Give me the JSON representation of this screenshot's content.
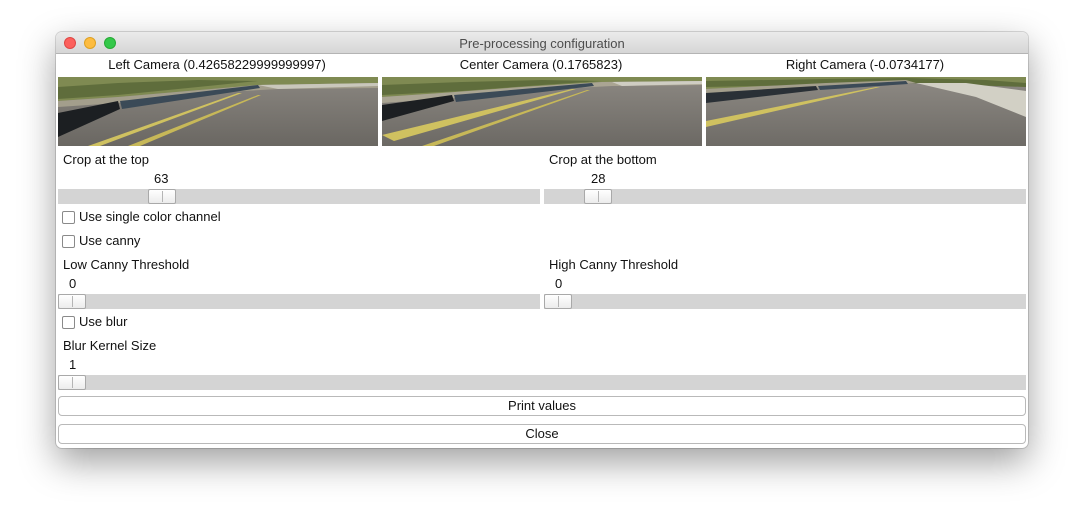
{
  "window": {
    "title": "Pre-processing configuration"
  },
  "cameras": [
    {
      "label": "Left Camera (0.42658229999999997)"
    },
    {
      "label": "Center Camera (0.1765823)"
    },
    {
      "label": "Right Camera (-0.0734177)"
    }
  ],
  "crop_top": {
    "label": "Crop at the top",
    "value": "63"
  },
  "crop_bottom": {
    "label": "Crop at the bottom",
    "value": "28"
  },
  "checkboxes": {
    "single_channel": {
      "label": "Use single color channel",
      "checked": false
    },
    "canny": {
      "label": "Use canny",
      "checked": false
    },
    "blur": {
      "label": "Use blur",
      "checked": false
    }
  },
  "low_canny": {
    "label": "Low Canny Threshold",
    "value": "0"
  },
  "high_canny": {
    "label": "High Canny Threshold",
    "value": "0"
  },
  "blur_kernel": {
    "label": "Blur Kernel Size",
    "value": "1"
  },
  "buttons": {
    "print": "Print values",
    "close": "Close"
  }
}
